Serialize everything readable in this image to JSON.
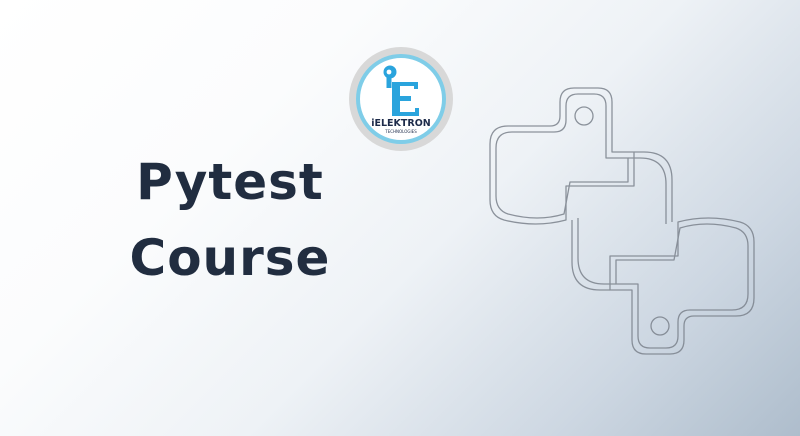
{
  "banner": {
    "title_line_1": "Pytest",
    "title_line_2": "Course",
    "logo": {
      "name": "ielektron-technologies-logo",
      "letter": "E",
      "wordmark": "iELEKTRON",
      "tagline": "TECHNOLOGIES",
      "ring_color": "#7fcde8",
      "badge_color": "#d8d8d8",
      "letter_color": "#2aa4dd",
      "wordmark_color": "#1d2b4a"
    },
    "python_icon": "python-logo-outline-icon",
    "colors": {
      "title": "#212d40",
      "background_start": "#ffffff",
      "background_end": "#aebdcc",
      "outline": "#7b828c"
    }
  }
}
